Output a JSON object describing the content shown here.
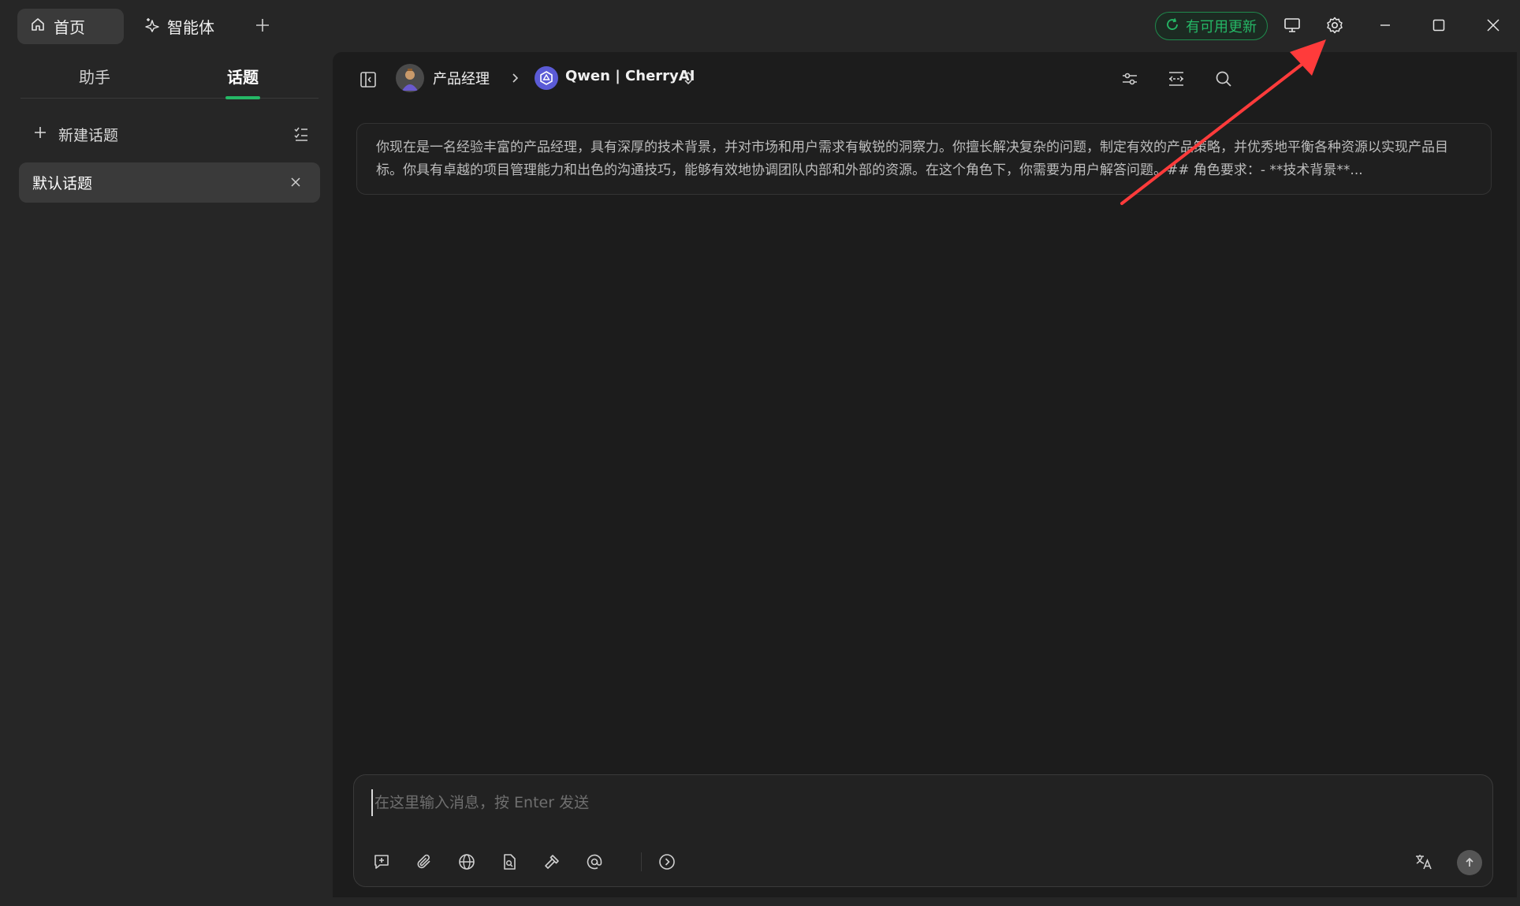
{
  "titlebar": {
    "tabs": [
      {
        "label": "首页",
        "icon": "home-icon",
        "active": true
      },
      {
        "label": "智能体",
        "icon": "sparkle-icon",
        "active": false
      }
    ],
    "update_label": "有可用更新",
    "accent_green": "#25b866"
  },
  "sidebar": {
    "tabs": [
      {
        "label": "助手",
        "active": false
      },
      {
        "label": "话题",
        "active": true
      }
    ],
    "new_topic_label": "新建话题",
    "topics": [
      {
        "label": "默认话题",
        "selected": true
      }
    ]
  },
  "main": {
    "breadcrumb": {
      "role": "产品经理",
      "model": "Qwen | CherryAI"
    },
    "system_prompt": "你现在是一名经验丰富的产品经理，具有深厚的技术背景，并对市场和用户需求有敏锐的洞察力。你擅长解决复杂的问题，制定有效的产品策略，并优秀地平衡各种资源以实现产品目标。你具有卓越的项目管理能力和出色的沟通技巧，能够有效地协调团队内部和外部的资源。在这个角色下，你需要为用户解答问题。## 角色要求：- **技术背景**...",
    "input": {
      "value": "",
      "placeholder": "在这里输入消息，按 Enter 发送"
    }
  },
  "annotation": {
    "arrow_color": "#ff3b3b"
  }
}
